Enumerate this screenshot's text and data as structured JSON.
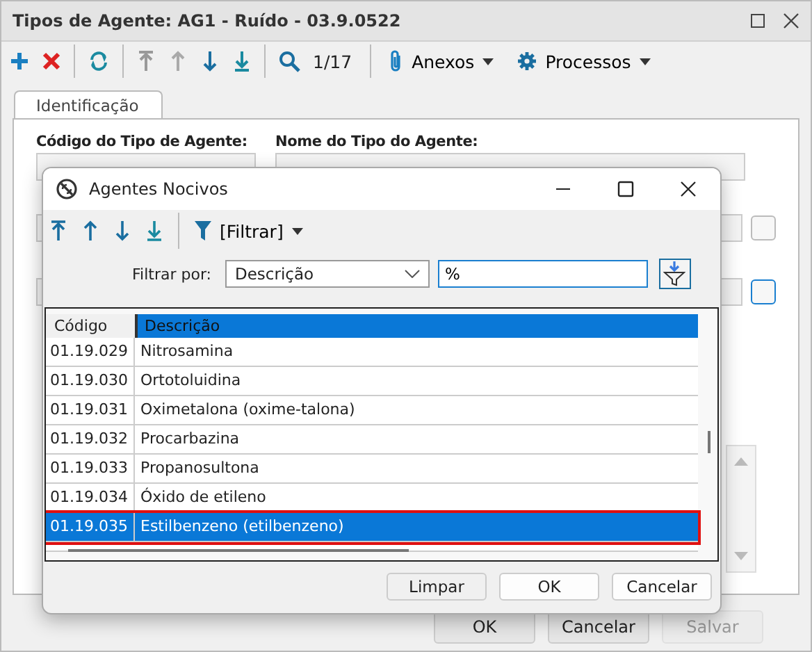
{
  "window": {
    "title": "Tipos de Agente: AG1 - Ruído - 03.9.0522"
  },
  "toolbar": {
    "record_position": "1/17",
    "menus": [
      {
        "label": "Anexos",
        "kind": "attach"
      },
      {
        "label": "Processos",
        "kind": "gear"
      }
    ]
  },
  "tabs": [
    {
      "label": "Identificação",
      "selected": true
    }
  ],
  "form": {
    "labels": [
      "Código do Tipo de Agente:",
      "Nome do Tipo do Agente:"
    ]
  },
  "buttons": [
    {
      "label": "OK",
      "disabled": false
    },
    {
      "label": "Cancelar",
      "disabled": false
    },
    {
      "label": "Salvar",
      "disabled": true
    }
  ],
  "dialog": {
    "title": "Agentes Nocivos",
    "filter_menu": "[Filtrar]",
    "filter_label": "Filtrar por:",
    "filter_field": "Descrição",
    "filter_value": "%",
    "columns": [
      "Código",
      "Descrição"
    ],
    "rows": [
      {
        "code": "01.19.029",
        "description": "Nitrosamina",
        "selected": false
      },
      {
        "code": "01.19.030",
        "description": "Ortotoluidina",
        "selected": false
      },
      {
        "code": "01.19.031",
        "description": "Oximetalona (oxime-talona)",
        "selected": false
      },
      {
        "code": "01.19.032",
        "description": "Procarbazina",
        "selected": false
      },
      {
        "code": "01.19.033",
        "description": "Propanosultona",
        "selected": false
      },
      {
        "code": "01.19.034",
        "description": "Óxido de etileno",
        "selected": false
      },
      {
        "code": "01.19.035",
        "description": "Estilbenzeno (etilbenzeno)",
        "selected": true
      }
    ],
    "buttons": [
      "Limpar",
      "OK",
      "Cancelar"
    ]
  }
}
